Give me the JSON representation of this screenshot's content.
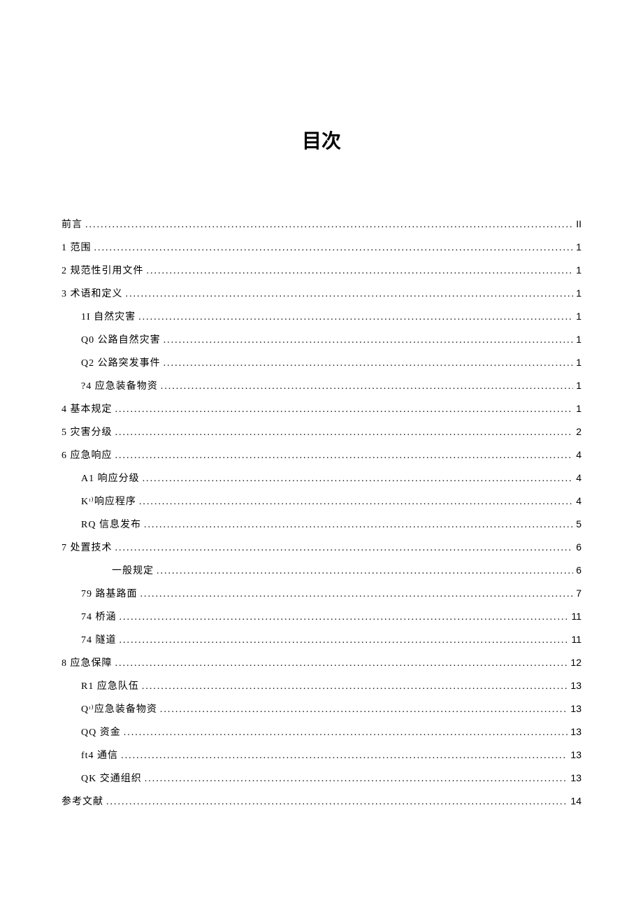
{
  "title": "目次",
  "entries": [
    {
      "level": 1,
      "label": "前言",
      "page": "II"
    },
    {
      "level": 1,
      "label": "1 范围",
      "page": "1"
    },
    {
      "level": 1,
      "label": "2 规范性引用文件",
      "page": "1"
    },
    {
      "level": 1,
      "label": "3 术语和定义",
      "page": "1"
    },
    {
      "level": 2,
      "label": "1I 自然灾害",
      "page": "1"
    },
    {
      "level": 2,
      "label": "Q0 公路自然灾害",
      "page": "1"
    },
    {
      "level": 2,
      "label": "Q2 公路突发事件",
      "page": "1"
    },
    {
      "level": 2,
      "label": "?4 应急装备物资",
      "page": "1"
    },
    {
      "level": 1,
      "label": "4 基本规定",
      "page": "1"
    },
    {
      "level": 1,
      "label": "5 灾害分级",
      "page": "2"
    },
    {
      "level": 1,
      "label": "6 应急响应",
      "page": "4"
    },
    {
      "level": 2,
      "label": "A1 响应分级",
      "page": "4"
    },
    {
      "level": 2,
      "label": "Kᶦ⁾响应程序",
      "page": "4"
    },
    {
      "level": 2,
      "label": "RQ 信息发布",
      "page": "5"
    },
    {
      "level": 1,
      "label": "7 处置技术",
      "page": "6"
    },
    {
      "level": 3,
      "label": "一般规定",
      "page": "6"
    },
    {
      "level": 2,
      "label": "79 路基路面",
      "page": "7"
    },
    {
      "level": 2,
      "label": "74 桥涵",
      "page": "11"
    },
    {
      "level": 2,
      "label": "74 隧道",
      "page": "11"
    },
    {
      "level": 1,
      "label": "8 应急保障",
      "page": "12"
    },
    {
      "level": 2,
      "label": "R1 应急队伍",
      "page": "13"
    },
    {
      "level": 2,
      "label": "Qᶦ⁾应急装备物资",
      "page": "13"
    },
    {
      "level": 2,
      "label": "QQ 资金",
      "page": "13"
    },
    {
      "level": 2,
      "label": "ft4 通信",
      "page": "13"
    },
    {
      "level": 2,
      "label": "QK 交通组织",
      "page": "13"
    },
    {
      "level": 1,
      "label": "参考文献",
      "page": "14"
    }
  ]
}
